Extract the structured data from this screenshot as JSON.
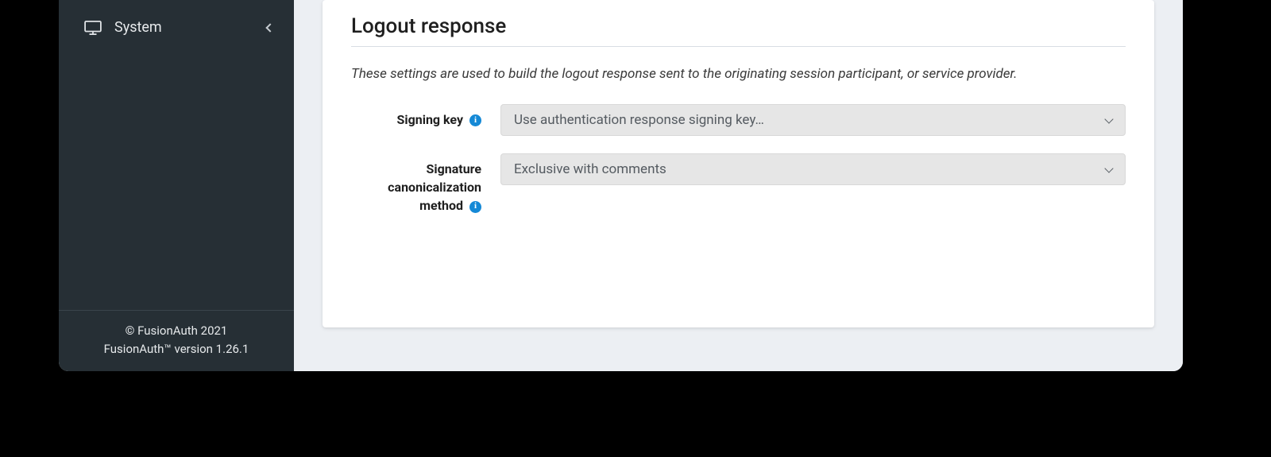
{
  "sidebar": {
    "items": [
      {
        "label": "System"
      }
    ],
    "footer": {
      "copyright": "© FusionAuth 2021",
      "version": "FusionAuth™ version 1.26.1"
    }
  },
  "main": {
    "section_title": "Logout response",
    "section_desc": "These settings are used to build the logout response sent to the originating session participant, or service provider.",
    "fields": {
      "signing_key": {
        "label": "Signing key",
        "value": "Use authentication response signing key…"
      },
      "canonicalization": {
        "label": "Signature canonicalization method",
        "value": "Exclusive with comments"
      }
    }
  }
}
